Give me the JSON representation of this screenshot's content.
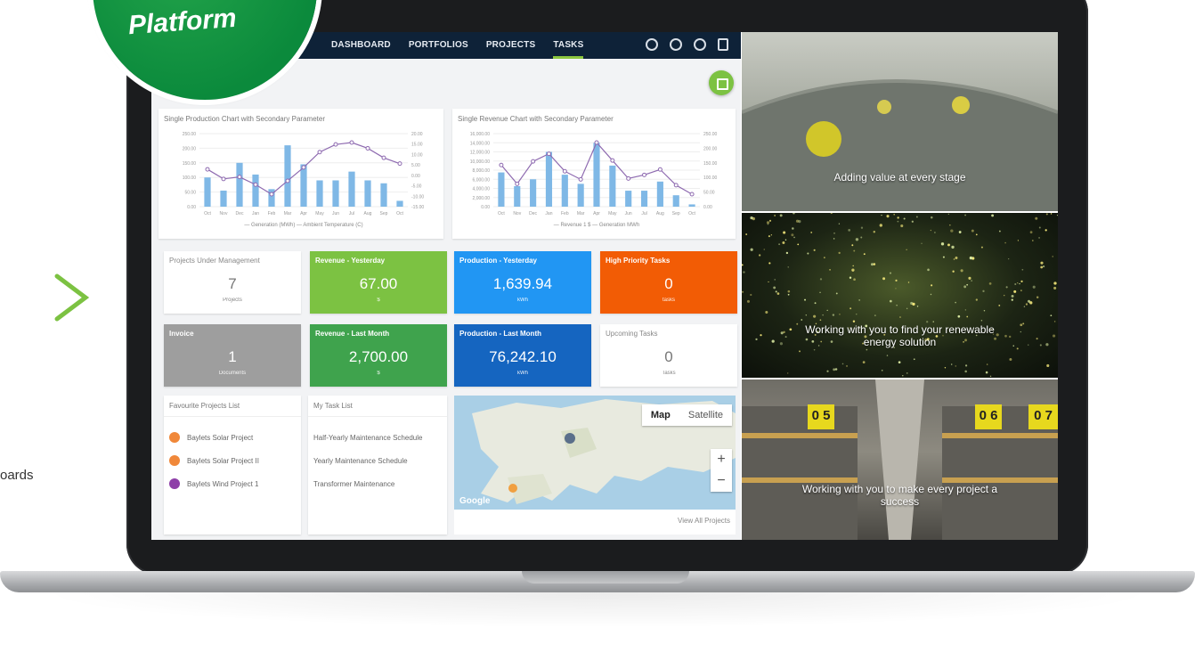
{
  "badge": {
    "text": "Platform"
  },
  "left_caption": "oards",
  "nav": {
    "items": [
      "DASHBOARD",
      "PORTFOLIOS",
      "PROJECTS",
      "TASKS"
    ],
    "active": "TASKS"
  },
  "charts": {
    "production": {
      "title": "Single Production Chart with Secondary Parameter",
      "legend": "— Generation (MWh) — Ambient Temperature (C)"
    },
    "revenue": {
      "title": "Single Revenue Chart with Secondary Parameter",
      "legend": "— Revenue 1 $ — Generation MWh"
    }
  },
  "chart_data": [
    {
      "type": "bar",
      "title": "Single Production Chart with Secondary Parameter",
      "categories": [
        "Oct",
        "Nov",
        "Dec",
        "Jan",
        "Feb",
        "Mar",
        "Apr",
        "May",
        "Jun",
        "Jul",
        "Aug",
        "Sep",
        "Oct"
      ],
      "series": [
        {
          "name": "Generation (MWh)",
          "type": "bar",
          "values": [
            100,
            55,
            150,
            110,
            60,
            210,
            145,
            90,
            90,
            120,
            90,
            80,
            20
          ]
        },
        {
          "name": "Ambient Temperature (C)",
          "type": "line",
          "values": [
            3,
            -2,
            -1,
            -5,
            -10,
            -3,
            4,
            12,
            16,
            17,
            14,
            9,
            6
          ]
        }
      ],
      "ylim_left": [
        0,
        250
      ],
      "left_ticks": [
        "250.00",
        "200.00",
        "150.00",
        "100.00",
        "50.00",
        "0.00"
      ],
      "right_ticks": [
        "20.00",
        "15.00",
        "10.00",
        "5.00",
        "0.00",
        "-5.00",
        "-10.00",
        "-15.00"
      ]
    },
    {
      "type": "bar",
      "title": "Single Revenue Chart with Secondary Parameter",
      "categories": [
        "Oct",
        "Nov",
        "Dec",
        "Jan",
        "Feb",
        "Mar",
        "Apr",
        "May",
        "Jun",
        "Jul",
        "Aug",
        "Sep",
        "Oct"
      ],
      "series": [
        {
          "name": "Revenue 1 $",
          "type": "line",
          "values": [
            7000,
            2800,
            7800,
            9500,
            5600,
            3800,
            12000,
            8000,
            4000,
            4800,
            6000,
            2500,
            500
          ]
        },
        {
          "name": "Generation MWh",
          "type": "bar",
          "values": [
            7500,
            4500,
            6000,
            12000,
            7000,
            5000,
            14000,
            9000,
            3500,
            3500,
            5500,
            2500,
            500
          ]
        }
      ],
      "ylim_left": [
        0,
        16000
      ],
      "left_ticks": [
        "16,000.00",
        "14,000.00",
        "12,000.00",
        "10,000.00",
        "8,000.00",
        "6,000.00",
        "4,000.00",
        "2,000.00",
        "0.00"
      ],
      "right_ticks": [
        "250.00",
        "200.00",
        "150.00",
        "100.00",
        "50.00",
        "0.00"
      ]
    }
  ],
  "kpis": {
    "projects": {
      "title": "Projects Under Management",
      "value": "7",
      "unit": "Projects"
    },
    "rev_yesterday": {
      "title": "Revenue - Yesterday",
      "value": "67.00",
      "unit": "$"
    },
    "prod_yesterday": {
      "title": "Production - Yesterday",
      "value": "1,639.94",
      "unit": "kWh"
    },
    "high_priority": {
      "title": "High Priority Tasks",
      "value": "0",
      "unit": "tasks"
    },
    "invoice": {
      "title": "Invoice",
      "value": "1",
      "unit": "Documents"
    },
    "rev_last_month": {
      "title": "Revenue - Last Month",
      "value": "2,700.00",
      "unit": "$"
    },
    "prod_last_month": {
      "title": "Production - Last Month",
      "value": "76,242.10",
      "unit": "kWh"
    },
    "upcoming": {
      "title": "Upcoming Tasks",
      "value": "0",
      "unit": "Tasks"
    }
  },
  "favorites": {
    "title": "Favourite Projects List",
    "items": [
      "Baylets Solar Project",
      "Baylets Solar Project II",
      "Baylets Wind Project 1"
    ]
  },
  "tasks": {
    "title": "My Task List",
    "items": [
      "Half-Yearly Maintenance Schedule",
      "Yearly Maintenance Schedule",
      "Transformer Maintenance"
    ]
  },
  "map": {
    "map_label": "Map",
    "satellite_label": "Satellite",
    "zoom_in": "+",
    "zoom_out": "−",
    "google": "Google",
    "view_all": "View All Projects"
  },
  "photos": [
    {
      "caption": "Adding value at every stage"
    },
    {
      "caption": "Working with you to find your renewable energy solution"
    },
    {
      "caption": "Working with you to make every project a success"
    }
  ],
  "shelf_numbers": [
    "0 5",
    "0 6",
    "0 7"
  ],
  "colors": {
    "nav_bg": "#0e2238",
    "green": "#7cc242",
    "blue": "#2196f3",
    "orange": "#f25c05",
    "gray": "#9e9e9e",
    "dark_green": "#3fa34d",
    "dark_blue": "#1565c0",
    "bar": "#7fb8e6",
    "line": "#8e6ab0"
  }
}
